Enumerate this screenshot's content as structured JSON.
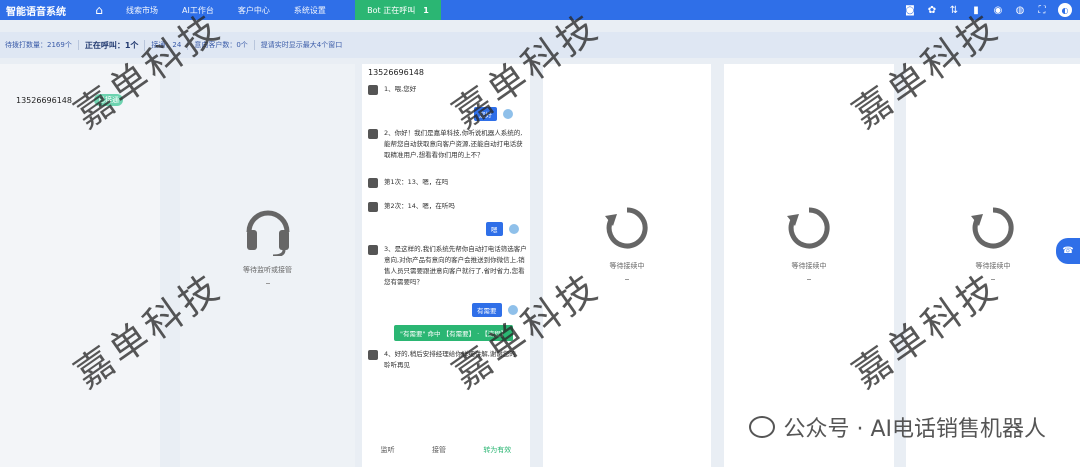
{
  "header": {
    "brand": "智能语音系统",
    "nav": [
      "线索市场",
      "AI工作台",
      "客户中心",
      "系统设置"
    ],
    "call": {
      "label": "Bot 正在呼叫",
      "count": "1"
    }
  },
  "status": {
    "pending": "待拨打数量：2169个",
    "calling": "正在呼叫：1个",
    "connected": "接通：24",
    "intent": "意向客户数：0个",
    "tip": "提请实时显示最大4个窗口"
  },
  "left_panel": {
    "phone": "13526696148",
    "tag": "已接通"
  },
  "monitor_panel": {
    "label": "等待监听或接管"
  },
  "chat": {
    "phone": "13526696148",
    "messages": [
      "1、喂,您好",
      "2、你好！我们是嘉单科技,你听说机器人系统的,能帮您自动获取意向客户资源,还能自动打电话获取精准用户,想看看你们用的上不？",
      "第1次：13、嗯，在吗",
      "第2次：14、嗯，在听吗",
      "3、是这样的,我们系统先帮你自动打电话筛选客户意向,对你产品有意向的客户会推送到你微信上,销售人员只需要跟进意向客户就行了,省时省力,您看您有需要吗？",
      "4、好的,稍后安排经理给你详细讲解,谢谢您的聆听再见"
    ],
    "replies": [
      "您好",
      "嗯",
      "有需要"
    ],
    "flow_tag": "\"有需要\" 命中 【有需要】 · 【流程】",
    "footer": [
      "监听",
      "接管",
      "转为有效"
    ]
  },
  "waiting_panels": [
    "等待接续中",
    "等待接续中",
    "等待接续中"
  ],
  "watermark": "嘉单科技",
  "footer_wm": "公众号 · AI电话销售机器人",
  "colors": {
    "primary": "#2f6fe8",
    "success": "#2bb673"
  }
}
